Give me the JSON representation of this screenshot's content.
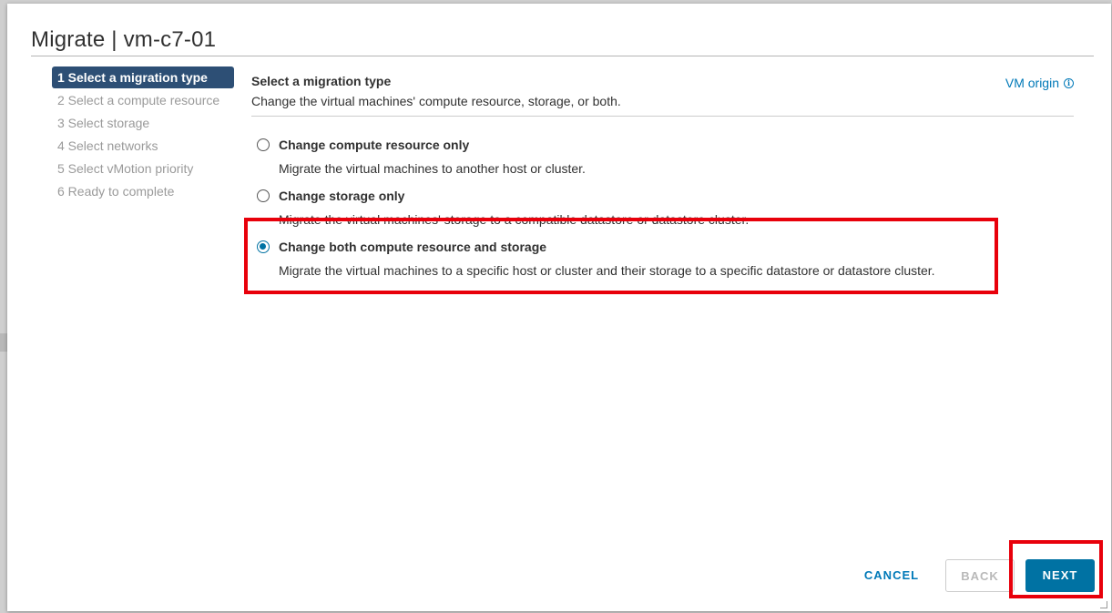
{
  "dialog": {
    "title": "Migrate | vm-c7-01"
  },
  "steps": [
    {
      "label": "1 Select a migration type",
      "active": true
    },
    {
      "label": "2 Select a compute resource",
      "active": false
    },
    {
      "label": "3 Select storage",
      "active": false
    },
    {
      "label": "4 Select networks",
      "active": false
    },
    {
      "label": "5 Select vMotion priority",
      "active": false
    },
    {
      "label": "6 Ready to complete",
      "active": false
    }
  ],
  "main": {
    "heading": "Select a migration type",
    "description": "Change the virtual machines' compute resource, storage, or both.",
    "origin_link": "VM origin",
    "info_icon": "info-circle-icon",
    "options": [
      {
        "label": "Change compute resource only",
        "description": "Migrate the virtual machines to another host or cluster.",
        "selected": false
      },
      {
        "label": "Change storage only",
        "description": "Migrate the virtual machines' storage to a compatible datastore or datastore cluster.",
        "selected": false
      },
      {
        "label": "Change both compute resource and storage",
        "description": "Migrate the virtual machines to a specific host or cluster and their storage to a specific datastore or datastore cluster.",
        "selected": true
      }
    ]
  },
  "footer": {
    "cancel_label": "CANCEL",
    "back_label": "BACK",
    "next_label": "NEXT"
  },
  "colors": {
    "accent": "#0072a3",
    "active_step_bg": "#2d4f75",
    "highlight": "#e8000b"
  }
}
